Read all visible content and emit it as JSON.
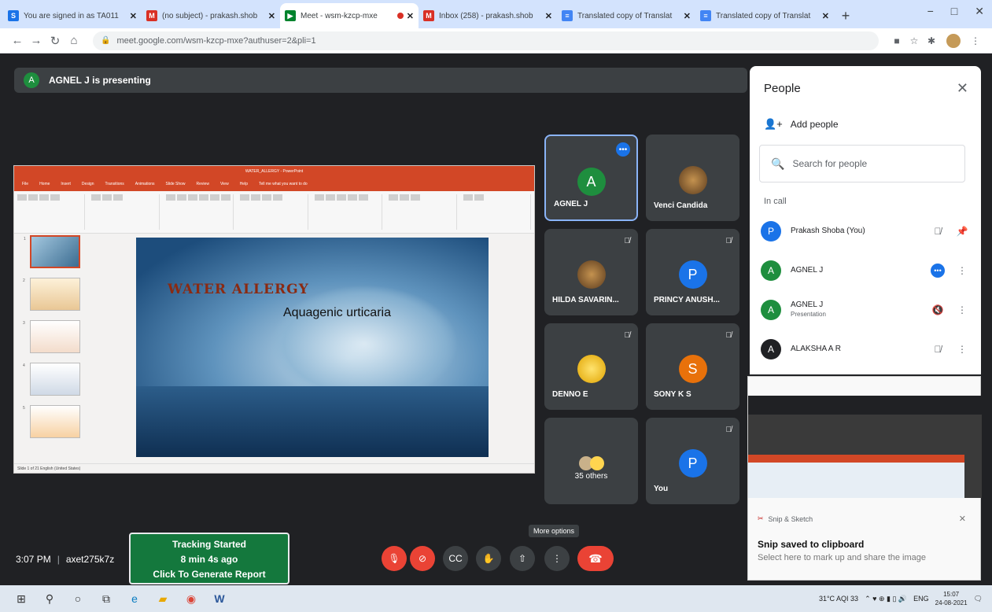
{
  "tabs": [
    {
      "title": "You are signed in as TA011",
      "favicon": "S",
      "color": "#1a73e8",
      "active": false
    },
    {
      "title": "(no subject) - prakash.shob",
      "favicon": "M",
      "color": "#d93025",
      "active": false
    },
    {
      "title": "Meet - wsm-kzcp-mxe",
      "favicon": "▶",
      "color": "#00832d",
      "active": true
    },
    {
      "title": "Inbox (258) - prakash.shob",
      "favicon": "M",
      "color": "#d93025",
      "active": false
    },
    {
      "title": "Translated copy of Translat",
      "favicon": "≡",
      "color": "#4285f4",
      "active": false
    },
    {
      "title": "Translated copy of Translat",
      "favicon": "≡",
      "color": "#4285f4",
      "active": false
    }
  ],
  "new_tab_label": "+",
  "window_controls": {
    "minimize": "−",
    "maximize": "□",
    "close": "✕"
  },
  "address_bar": {
    "url": "meet.google.com/wsm-kzcp-mxe?authuser=2&pli=1"
  },
  "presenter_bar": {
    "avatar_letter": "A",
    "text": "AGNEL J is presenting"
  },
  "slide": {
    "app_title": "WATER_ALLERGY - PowerPoint",
    "ribbon_tabs": [
      "File",
      "Home",
      "Insert",
      "Design",
      "Transitions",
      "Animations",
      "Slide Show",
      "Review",
      "View",
      "Help",
      "Tell me what you want to do"
    ],
    "title": "WATER ALLERGY",
    "subtitle": "Aquagenic urticaria",
    "status": "Slide 1 of 21    English (United States)"
  },
  "tiles": [
    {
      "name": "AGNEL J",
      "letter": "A",
      "color": "#1e8e3e",
      "kind": "letter",
      "active": true,
      "more": "•••"
    },
    {
      "name": "Venci Candida",
      "kind": "photo"
    },
    {
      "name": "HILDA SAVARIN...",
      "kind": "photo",
      "muted": true
    },
    {
      "name": "PRINCY ANUSH...",
      "letter": "P",
      "color": "#1a73e8",
      "kind": "letter",
      "muted": true
    },
    {
      "name": "DENNO E",
      "kind": "emoji",
      "muted": true
    },
    {
      "name": "SONY K S",
      "letter": "S",
      "color": "#e8710a",
      "kind": "letter",
      "muted": true
    },
    {
      "name": "35 others",
      "kind": "group"
    },
    {
      "name": "You",
      "letter": "P",
      "color": "#1a73e8",
      "kind": "letter",
      "muted": true
    }
  ],
  "people_panel": {
    "title": "People",
    "add_people": "Add people",
    "search_placeholder": "Search for people",
    "section": "In call",
    "people": [
      {
        "name": "Prakash Shoba (You)",
        "sub": "",
        "letter": "P",
        "color": "#1a73e8",
        "a1": "🎙̸",
        "a2": "📌"
      },
      {
        "name": "AGNEL J",
        "sub": "",
        "letter": "A",
        "color": "#1e8e3e",
        "a1": "•••",
        "a2": "⋮"
      },
      {
        "name": "AGNEL J",
        "sub": "Presentation",
        "letter": "A",
        "color": "#1e8e3e",
        "a1": "🔇",
        "a2": "⋮"
      },
      {
        "name": "ALAKSHA A R",
        "sub": "",
        "letter": "A",
        "color": "#202124",
        "a1": "🎙̸",
        "a2": "⋮"
      }
    ]
  },
  "snip": {
    "app": "Snip & Sketch",
    "title": "Snip saved to clipboard",
    "desc": "Select here to mark up and share the image"
  },
  "bottom_bar": {
    "time": "3:07 PM",
    "meeting_code": "axet275k7z",
    "tooltip": "More options"
  },
  "tracking": {
    "line1": "Tracking Started",
    "line2": "8 min 4s ago",
    "line3": "Click To Generate Report"
  },
  "taskbar": {
    "weather": "31°C AQI 33",
    "lang": "ENG",
    "time": "15:07",
    "date": "24-08-2021"
  }
}
